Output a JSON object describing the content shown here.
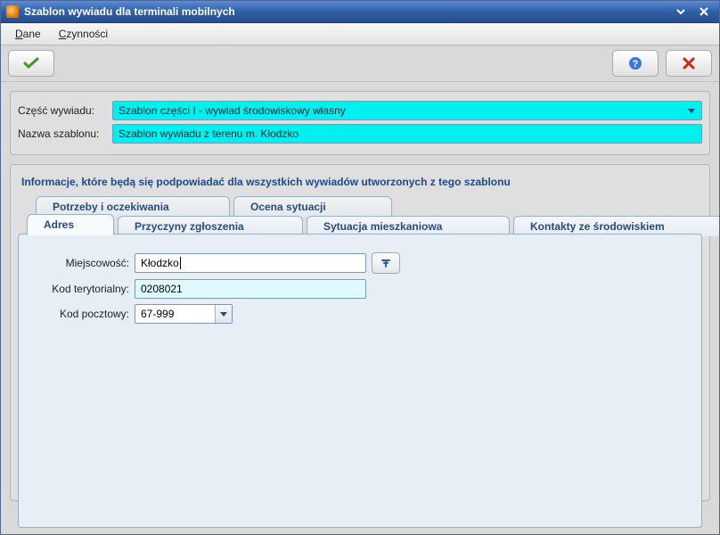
{
  "window": {
    "title": "Szablon wywiadu dla terminali mobilnych"
  },
  "menu": {
    "dane": "Dane",
    "czynnosci": "Czynności"
  },
  "top_form": {
    "part_label": "Część wywiadu:",
    "part_value": "Szablon części I - wywiad środowiskowy własny",
    "name_label": "Nazwa szablonu:",
    "name_value": "Szablon wywiadu z terenu m. Kłodzko"
  },
  "section_heading": "Informacje, które będą się podpowiadać dla wszystkich wywiadów utworzonych z tego szablonu",
  "tabs_row1": {
    "potrzeby": "Potrzeby i oczekiwania",
    "ocena": "Ocena sytuacji"
  },
  "tabs_row2": {
    "adres": "Adres",
    "przyczyny": "Przyczyny zgłoszenia",
    "sytuacja": "Sytuacja mieszkaniowa",
    "kontakty": "Kontakty ze środowiskiem"
  },
  "adres": {
    "miejscowosc_label": "Miejscowość:",
    "miejscowosc_value": "Kłodzko",
    "kod_teryt_label": "Kod terytorialny:",
    "kod_teryt_value": "0208021",
    "kod_pocz_label": "Kod pocztowy:",
    "kod_pocz_value": "67-999"
  }
}
